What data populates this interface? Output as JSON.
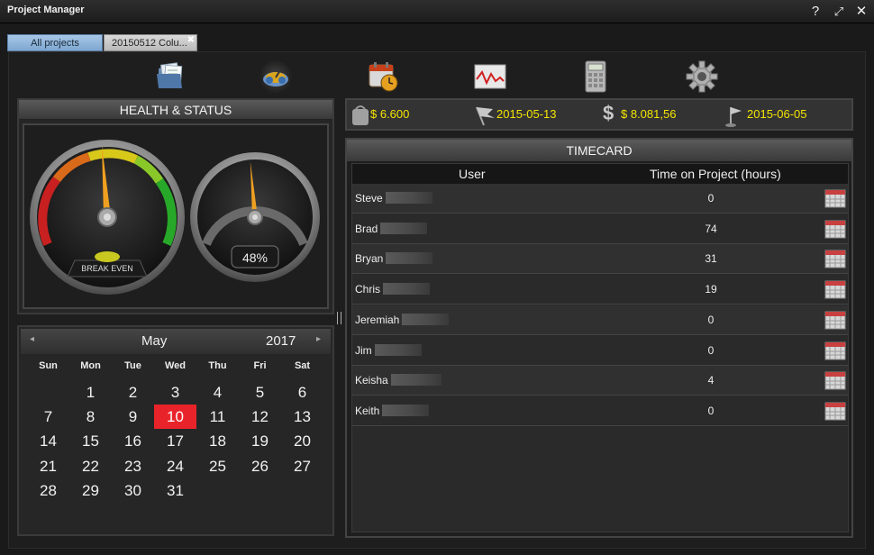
{
  "window": {
    "title": "Project Manager",
    "help_label": "?",
    "restore_label": "⤢",
    "close_label": "✕"
  },
  "tabs": [
    {
      "label": "All projects"
    },
    {
      "label": "20150512 Colu...",
      "close": "✖"
    }
  ],
  "toolbar": {
    "icons": [
      "documents-icon",
      "health-gauge-icon",
      "schedule-clock-icon",
      "chart-icon",
      "calculator-icon",
      "settings-gear-icon"
    ],
    "active": "health-gauge-icon"
  },
  "health": {
    "header": "HEALTH & STATUS",
    "gauge_left_label": "BREAK EVEN",
    "gauge_right_value": "48%",
    "gauge_right_fraction": 0.48
  },
  "calendar": {
    "month": "May",
    "year": "2017",
    "prev_arrow": "◂",
    "next_arrow": "▸",
    "weekdays": [
      "Sun",
      "Mon",
      "Tue",
      "Wed",
      "Thu",
      "Fri",
      "Sat"
    ],
    "today": "10",
    "weeks": [
      [
        "",
        "1",
        "2",
        "3",
        "4",
        "5",
        "6"
      ],
      [
        "7",
        "8",
        "9",
        "10",
        "11",
        "12",
        "13"
      ],
      [
        "14",
        "15",
        "16",
        "17",
        "18",
        "19",
        "20"
      ],
      [
        "21",
        "22",
        "23",
        "24",
        "25",
        "26",
        "27"
      ],
      [
        "28",
        "29",
        "30",
        "31",
        "",
        "",
        ""
      ]
    ]
  },
  "summary": {
    "budget": "$ 6.600",
    "start_date": "2015-05-13",
    "cost": "$ 8.081,56",
    "end_date": "2015-06-05"
  },
  "timecard": {
    "header": "TIMECARD",
    "columns": [
      "User",
      "Time on Project (hours)"
    ],
    "rows": [
      {
        "user": "Steve",
        "hours": "0"
      },
      {
        "user": "Brad",
        "hours": "74"
      },
      {
        "user": "Bryan",
        "hours": "31"
      },
      {
        "user": "Chris",
        "hours": "19"
      },
      {
        "user": "Jeremiah",
        "hours": "0"
      },
      {
        "user": "Jim",
        "hours": "0"
      },
      {
        "user": "Keisha",
        "hours": "4"
      },
      {
        "user": "Keith",
        "hours": "0"
      }
    ]
  },
  "colors": {
    "accent_yellow": "#f5e400",
    "today_red": "#e8242a",
    "gauge_needle": "#f0a020",
    "tab_active": "#8fb3dc"
  }
}
